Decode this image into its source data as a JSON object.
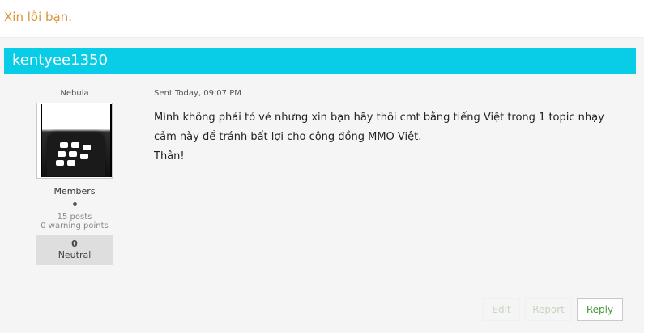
{
  "previous_post": {
    "text": "Xin lỗi bạn."
  },
  "post": {
    "author": "kentyee1350",
    "user_title": "Nebula",
    "avatar_icon": "blackberry-logo-icon",
    "group": "Members",
    "posts": "15 posts",
    "warning_points": "0 warning points",
    "reputation": {
      "value": "0",
      "label": "Neutral"
    },
    "sent": "Sent Today, 09:07 PM",
    "body": [
      "Mình không phải tỏ vẻ nhưng xin bạn hãy thôi cmt bằng tiếng Việt trong 1 topic nhạy",
      "cảm này để tránh bất lợi cho cộng đồng MMO Việt.",
      "Thân!"
    ],
    "actions": {
      "edit": "Edit",
      "report": "Report",
      "reply": "Reply"
    }
  },
  "colors": {
    "author_bar": "#09cde6",
    "previous_text": "#d9953a",
    "reply_text": "#4a9a3a"
  }
}
